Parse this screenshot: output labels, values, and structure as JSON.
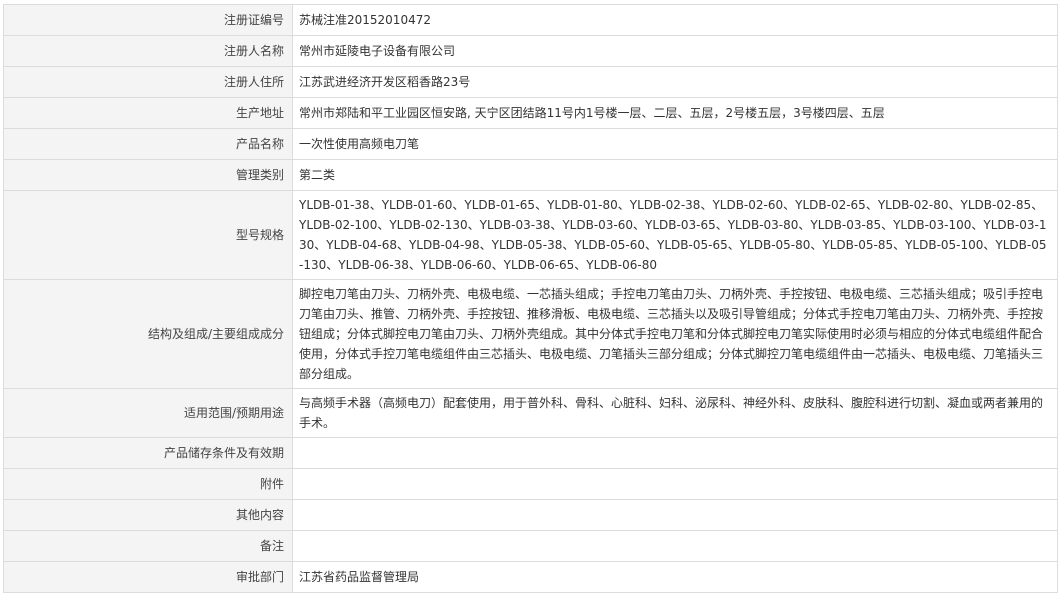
{
  "rows": [
    {
      "label": "注册证编号",
      "value": "苏械注准20152010472"
    },
    {
      "label": "注册人名称",
      "value": "常州市延陵电子设备有限公司"
    },
    {
      "label": "注册人住所",
      "value": "江苏武进经济开发区稻香路23号"
    },
    {
      "label": "生产地址",
      "value": "常州市郑陆和平工业园区恒安路, 天宁区团结路11号内1号楼一层、二层、五层，2号楼五层，3号楼四层、五层"
    },
    {
      "label": "产品名称",
      "value": "一次性使用高频电刀笔"
    },
    {
      "label": "管理类别",
      "value": "第二类"
    },
    {
      "label": "型号规格",
      "value": "YLDB-01-38、YLDB-01-60、YLDB-01-65、YLDB-01-80、YLDB-02-38、YLDB-02-60、YLDB-02-65、YLDB-02-80、YLDB-02-85、YLDB-02-100、YLDB-02-130、YLDB-03-38、YLDB-03-60、YLDB-03-65、YLDB-03-80、YLDB-03-85、YLDB-03-100、YLDB-03-130、YLDB-04-68、YLDB-04-98、YLDB-05-38、YLDB-05-60、YLDB-05-65、YLDB-05-80、YLDB-05-85、YLDB-05-100、YLDB-05-130、YLDB-06-38、YLDB-06-60、YLDB-06-65、YLDB-06-80"
    },
    {
      "label": "结构及组成/主要组成成分",
      "value": "脚控电刀笔由刀头、刀柄外壳、电极电缆、一芯插头组成；手控电刀笔由刀头、刀柄外壳、手控按钮、电极电缆、三芯插头组成；吸引手控电刀笔由刀头、推管、刀柄外壳、手控按钮、推移滑板、电极电缆、三芯插头以及吸引导管组成；分体式手控电刀笔由刀头、刀柄外壳、手控按钮组成；分体式脚控电刀笔由刀头、刀柄外壳组成。其中分体式手控电刀笔和分体式脚控电刀笔实际使用时必须与相应的分体式电缆组件配合使用，分体式手控刀笔电缆组件由三芯插头、电极电缆、刀笔插头三部分组成；分体式脚控刀笔电缆组件由一芯插头、电极电缆、刀笔插头三部分组成。"
    },
    {
      "label": "适用范围/预期用途",
      "value": "与高频手术器（高频电刀）配套使用，用于普外科、骨科、心脏科、妇科、泌尿科、神经外科、皮肤科、腹腔科进行切割、凝血或两者兼用的手术。"
    },
    {
      "label": "产品储存条件及有效期",
      "value": ""
    },
    {
      "label": "附件",
      "value": ""
    },
    {
      "label": "其他内容",
      "value": ""
    },
    {
      "label": "备注",
      "value": ""
    },
    {
      "label": "审批部门",
      "value": "江苏省药品监督管理局"
    }
  ]
}
